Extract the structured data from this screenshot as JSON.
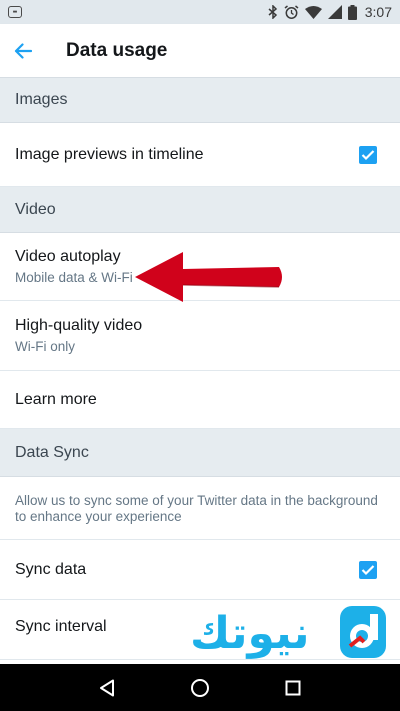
{
  "status_bar": {
    "time": "3:07",
    "notification_icon": "app-notification-icon",
    "icons": [
      "bluetooth-icon",
      "alarm-icon",
      "wifi-icon",
      "signal-icon",
      "battery-icon"
    ]
  },
  "app_bar": {
    "title": "Data usage",
    "back_icon": "arrow-left-icon"
  },
  "sections": {
    "images": {
      "header": "Images",
      "image_previews": {
        "label": "Image previews in timeline",
        "checked": true
      }
    },
    "video": {
      "header": "Video",
      "autoplay": {
        "label": "Video autoplay",
        "value": "Mobile data & Wi-Fi"
      },
      "high_quality": {
        "label": "High-quality video",
        "value": "Wi-Fi only"
      },
      "learn_more": {
        "label": "Learn more"
      }
    },
    "data_sync": {
      "header": "Data Sync",
      "description": "Allow us to sync some of your Twitter data in the background to enhance your experience",
      "sync_data": {
        "label": "Sync data",
        "checked": true
      },
      "sync_interval": {
        "label": "Sync interval"
      }
    }
  },
  "watermark": {
    "text": "نيوتك"
  },
  "nav_bar": {
    "icons": [
      "back-triangle-icon",
      "home-circle-icon",
      "recents-square-icon"
    ]
  },
  "colors": {
    "accent": "#1da1f2",
    "arrow": "#d0021b",
    "section_bg": "#e6ecf0"
  }
}
